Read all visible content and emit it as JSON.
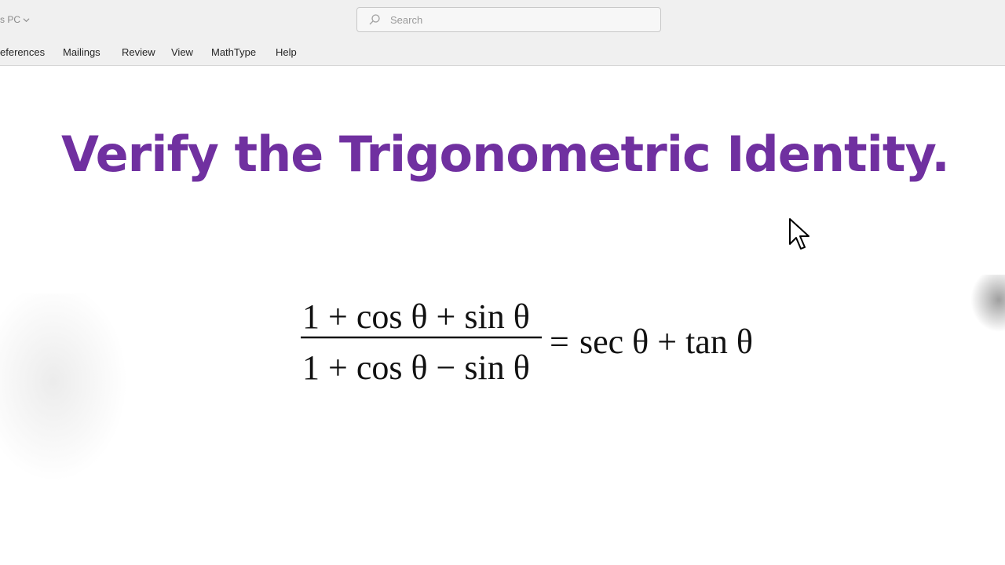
{
  "titlebar": {
    "location_label": "s PC",
    "search": {
      "placeholder": "Search",
      "value": ""
    }
  },
  "ribbon": {
    "tabs": [
      {
        "label": "eferences"
      },
      {
        "label": "Mailings"
      },
      {
        "label": "Review"
      },
      {
        "label": "View"
      },
      {
        "label": "MathType"
      },
      {
        "label": "Help"
      }
    ]
  },
  "document": {
    "heading": "Verify the Trigonometric Identity.",
    "heading_color": "#7030a0",
    "equation": {
      "numerator": "1 + cos θ + sin θ",
      "denominator": "1 + cos θ − sin θ",
      "equals": "=",
      "right_side": "sec θ + tan θ"
    }
  },
  "icons": {
    "search": "search-icon",
    "chevron": "chevron-down-icon",
    "cursor": "mouse-pointer-icon"
  }
}
